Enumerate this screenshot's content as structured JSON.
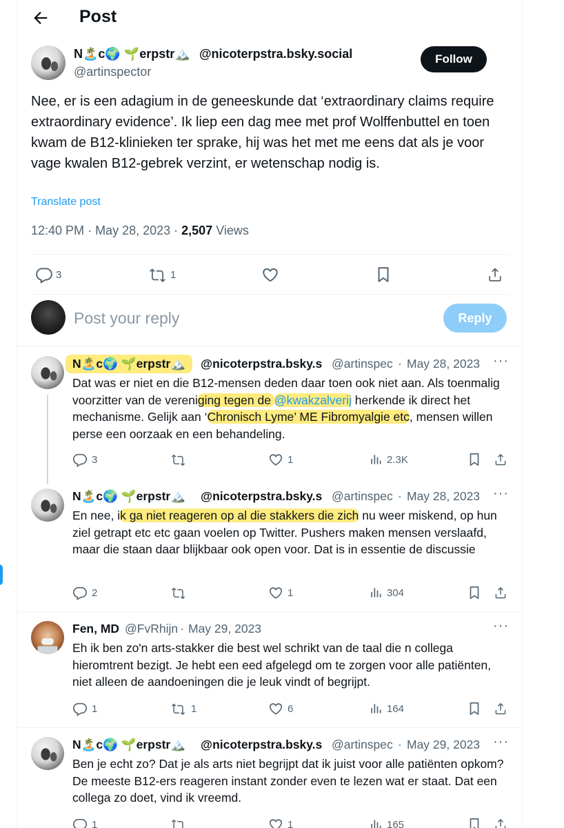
{
  "header": {
    "title": "Post"
  },
  "main_post": {
    "author_name": "N🏝️c🌍 🌱erpstr🏔️",
    "author_domain": "@nicoterpstra.bsky.social",
    "handle": "@artinspector",
    "follow_label": "Follow",
    "text": "Nee, er is een adagium in de geneeskunde dat ‘extraordinary claims require extraordinary evidence’. Ik liep een dag mee met prof Wolffenbuttel en toen kwam de B12-klinieken ter sprake, hij was het met me eens dat als je voor vage kwalen B12-gebrek verzint, er wetenschap nodig is.",
    "translate_label": "Translate post",
    "time": "12:40 PM",
    "date": "May 28, 2023",
    "views_count": "2,507",
    "views_label": "Views",
    "reply_count": "3",
    "repost_count": "1"
  },
  "reply_box": {
    "placeholder": "Post your reply",
    "button_label": "Reply"
  },
  "replies": [
    {
      "name": "N🏝️c🌍 🌱erpstr🏔️",
      "domain": "@nicoterpstra.bsky.s",
      "handle": "@artinspec",
      "sep": "·",
      "date": "May 28, 2023",
      "text_a": "Dat was er niet en die B12-mensen deden daar toen ook niet aan. Als toenmalig voorzitter van de vereni",
      "text_b": "ging tegen de ",
      "mention": "@kwakzalverij",
      "text_c": " herkende ik direct het mechanisme. Gelijk aan ‘",
      "text_d": "Chronisch Lyme’ ME Fibromyalgie etc",
      "text_e": ", mensen willen perse een oorzaak en een behandeling.",
      "replies": "3",
      "reposts": "",
      "likes": "1",
      "views": "2.3K"
    },
    {
      "name": "N🏝️c🌍 🌱erpstr🏔️",
      "domain": "@nicoterpstra.bsky.s",
      "handle": "@artinspec",
      "sep": "·",
      "date": "May 28, 2023",
      "text_a": "En nee, i",
      "text_b": "k ga niet reageren op al die stakkers die zich",
      "text_c": " nu weer miskend, op hun ziel getrapt etc etc gaan voelen op Twitter. Pushers maken mensen verslaafd, maar die staan daar blijkbaar ook open voor. Dat is in essentie de discussie",
      "replies": "2",
      "reposts": "",
      "likes": "1",
      "views": "304"
    },
    {
      "name": "Fen, MD",
      "handle": "@FvRhijn",
      "sep": "·",
      "date": "May 29, 2023",
      "text": "Eh ik ben zo'n arts-stakker die best wel schrikt van de taal die n collega hieromtrent bezigt. Je hebt een eed afgelegd om te zorgen voor alle patiënten, niet alleen de aandoeningen die je leuk vindt of begrijpt.",
      "replies": "1",
      "reposts": "1",
      "likes": "6",
      "views": "164"
    },
    {
      "name": "N🏝️c🌍 🌱erpstr🏔️",
      "domain": "@nicoterpstra.bsky.s",
      "handle": "@artinspec",
      "sep": "·",
      "date": "May 29, 2023",
      "text": "Ben je echt zo? Dat je als arts niet begrijpt dat ik juist voor alle patiënten opkom? De meeste B12-ers reageren instant zonder even te lezen wat er staat. Dat een collega zo doet, vind ik vreemd.",
      "replies": "1",
      "reposts": "",
      "likes": "1",
      "views": "165"
    }
  ],
  "colors": {
    "accent": "#1d9bf0",
    "highlight": "#ffde28",
    "text": "#0f1419",
    "muted": "#536471"
  }
}
